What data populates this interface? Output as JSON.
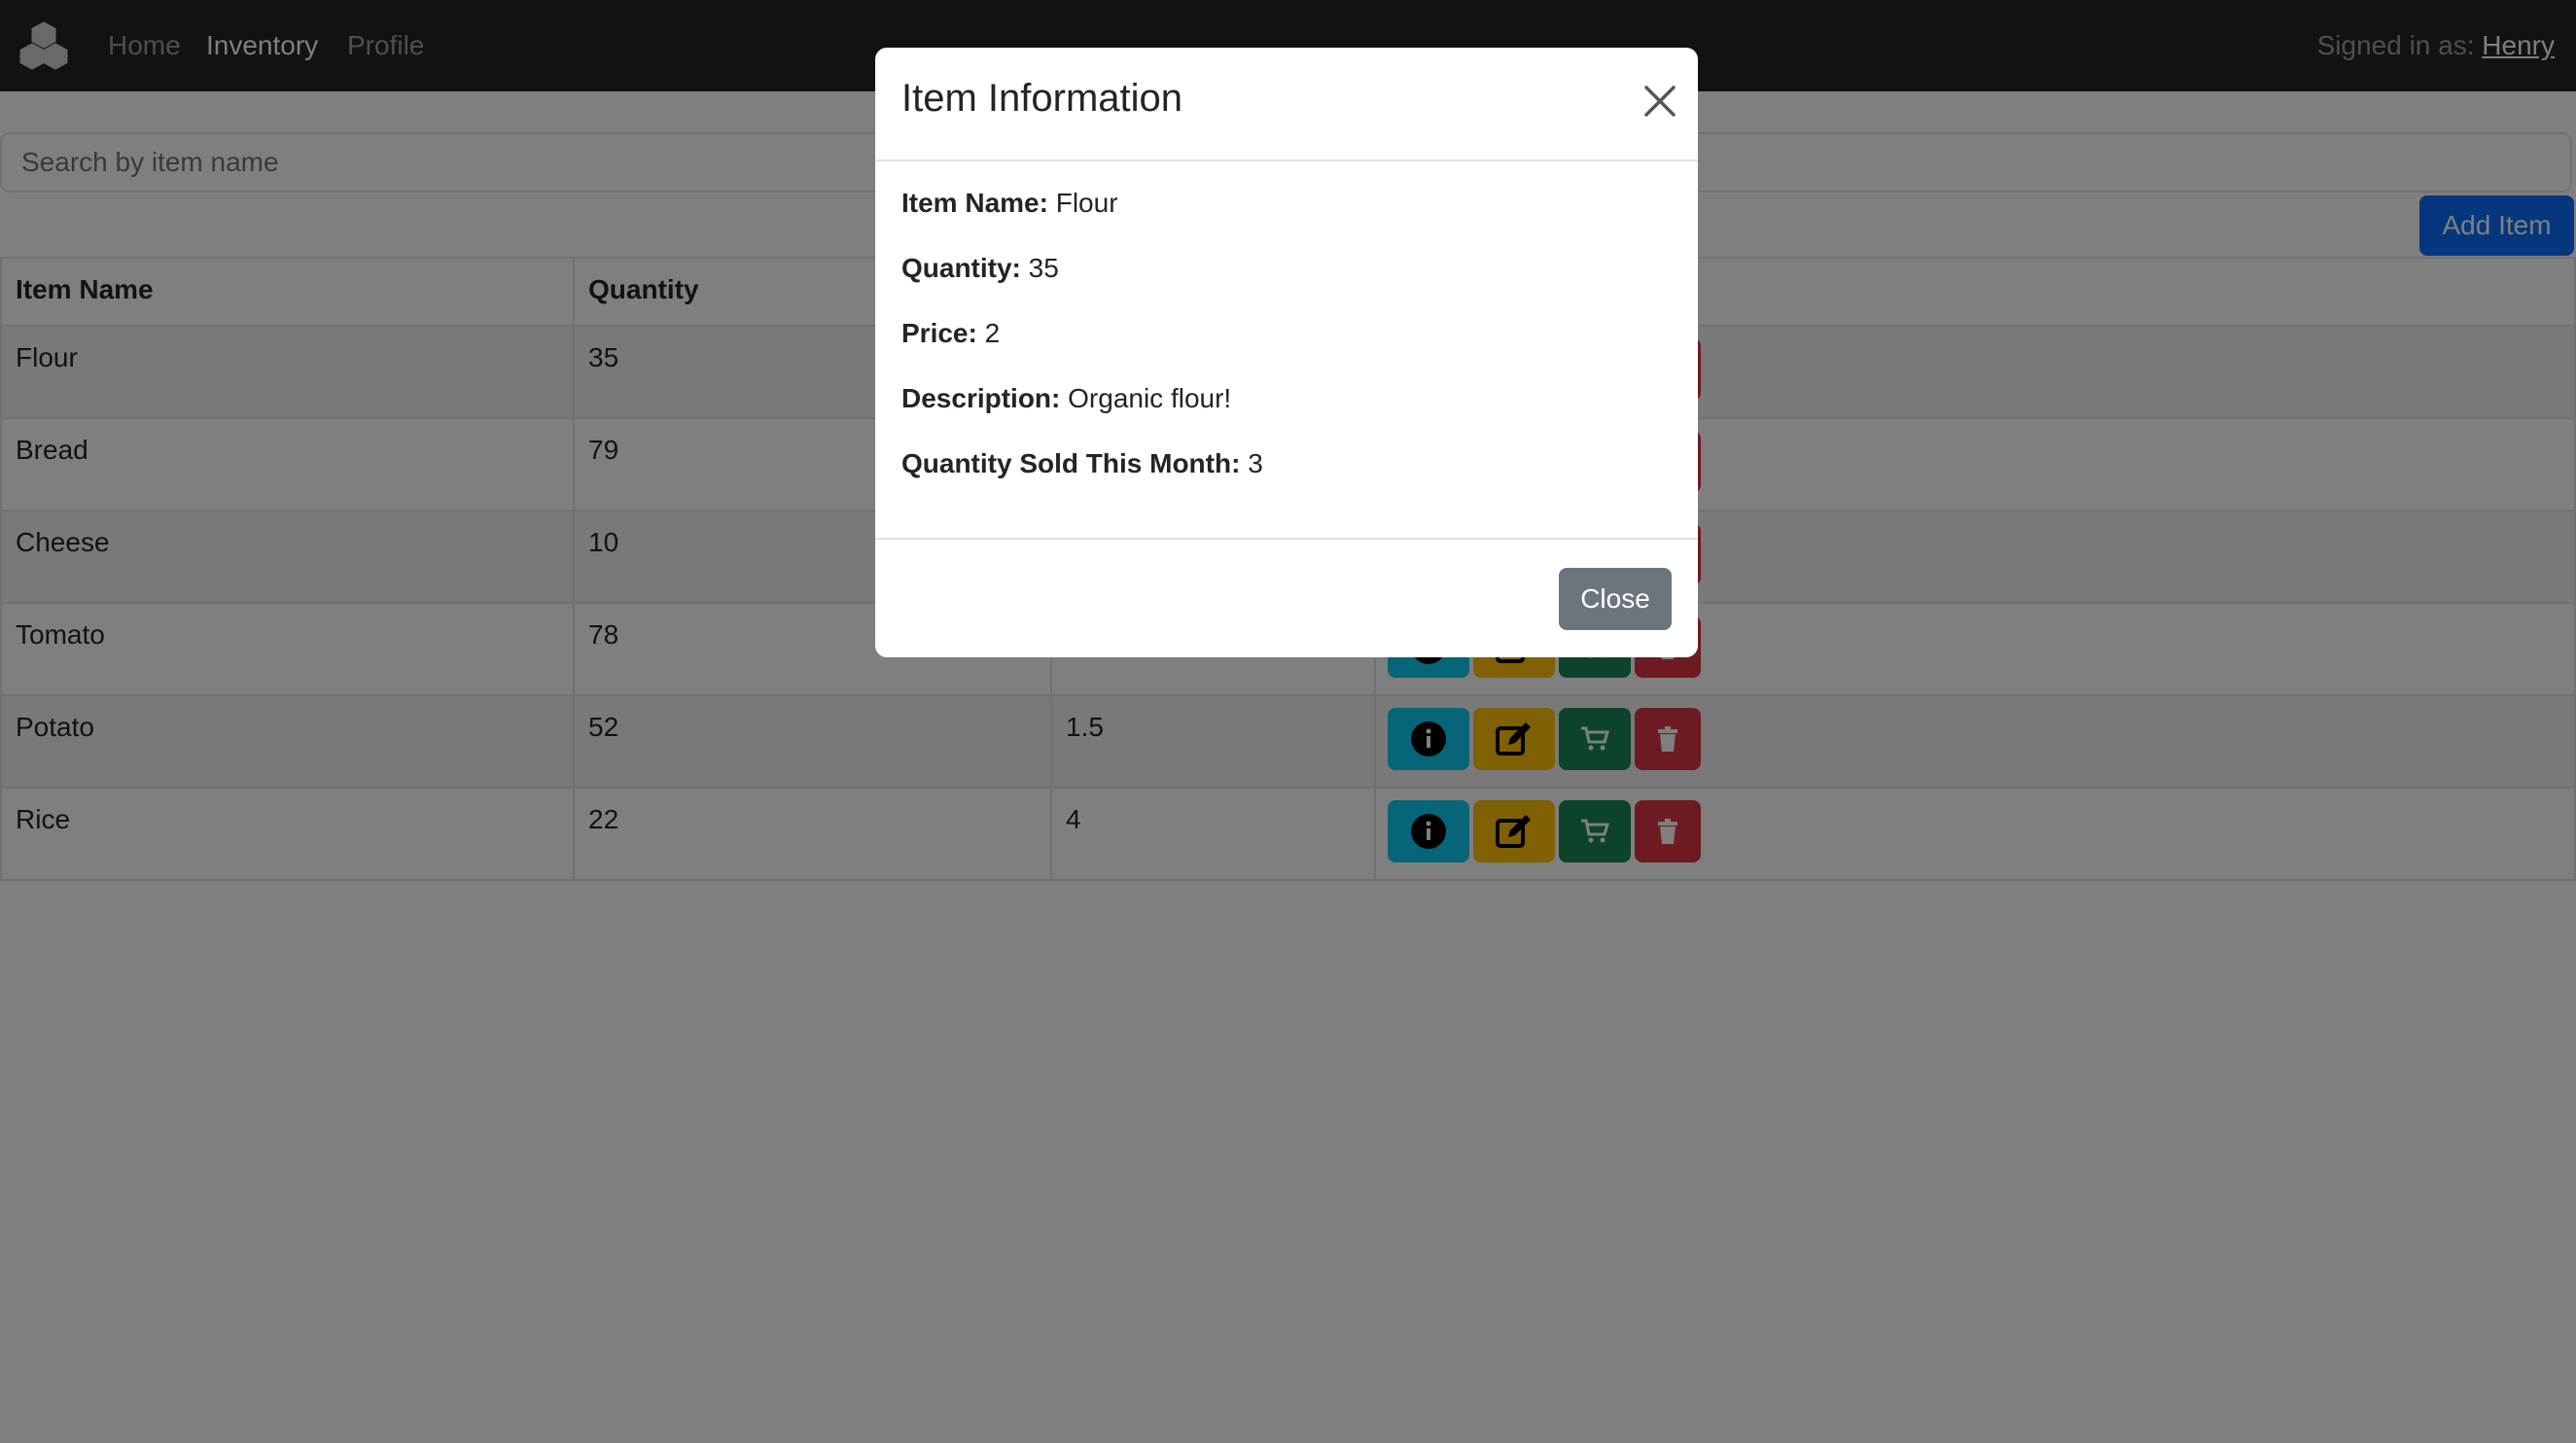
{
  "navbar": {
    "links": [
      "Home",
      "Inventory",
      "Profile"
    ],
    "signed_in_label": "Signed in as: ",
    "user": "Henry"
  },
  "search": {
    "placeholder": "Search by item name"
  },
  "toolbar": {
    "add_label": "Add Item"
  },
  "table": {
    "headers": [
      "Item Name",
      "Quantity"
    ],
    "rows": [
      {
        "name": "Flour",
        "quantity": "35",
        "price": ""
      },
      {
        "name": "Bread",
        "quantity": "79",
        "price": ""
      },
      {
        "name": "Cheese",
        "quantity": "10",
        "price": ""
      },
      {
        "name": "Tomato",
        "quantity": "78",
        "price": ""
      },
      {
        "name": "Potato",
        "quantity": "52",
        "price": "1.5"
      },
      {
        "name": "Rice",
        "quantity": "22",
        "price": "4"
      }
    ],
    "action_icons": [
      "info-icon",
      "edit-icon",
      "cart-icon",
      "trash-icon"
    ]
  },
  "modal": {
    "title": "Item Information",
    "fields": [
      {
        "label": "Item Name:",
        "value": "Flour"
      },
      {
        "label": "Quantity:",
        "value": "35"
      },
      {
        "label": "Price:",
        "value": "2"
      },
      {
        "label": "Description:",
        "value": "Organic flour!"
      },
      {
        "label": "Quantity Sold This Month:",
        "value": "3"
      }
    ],
    "close_label": "Close"
  },
  "colors": {
    "navbar": "#212529",
    "primary": "#0d6efd",
    "info": "#0dcaf0",
    "warning": "#ffc107",
    "success": "#198754",
    "danger": "#dc3545",
    "secondary": "#6c757d"
  }
}
